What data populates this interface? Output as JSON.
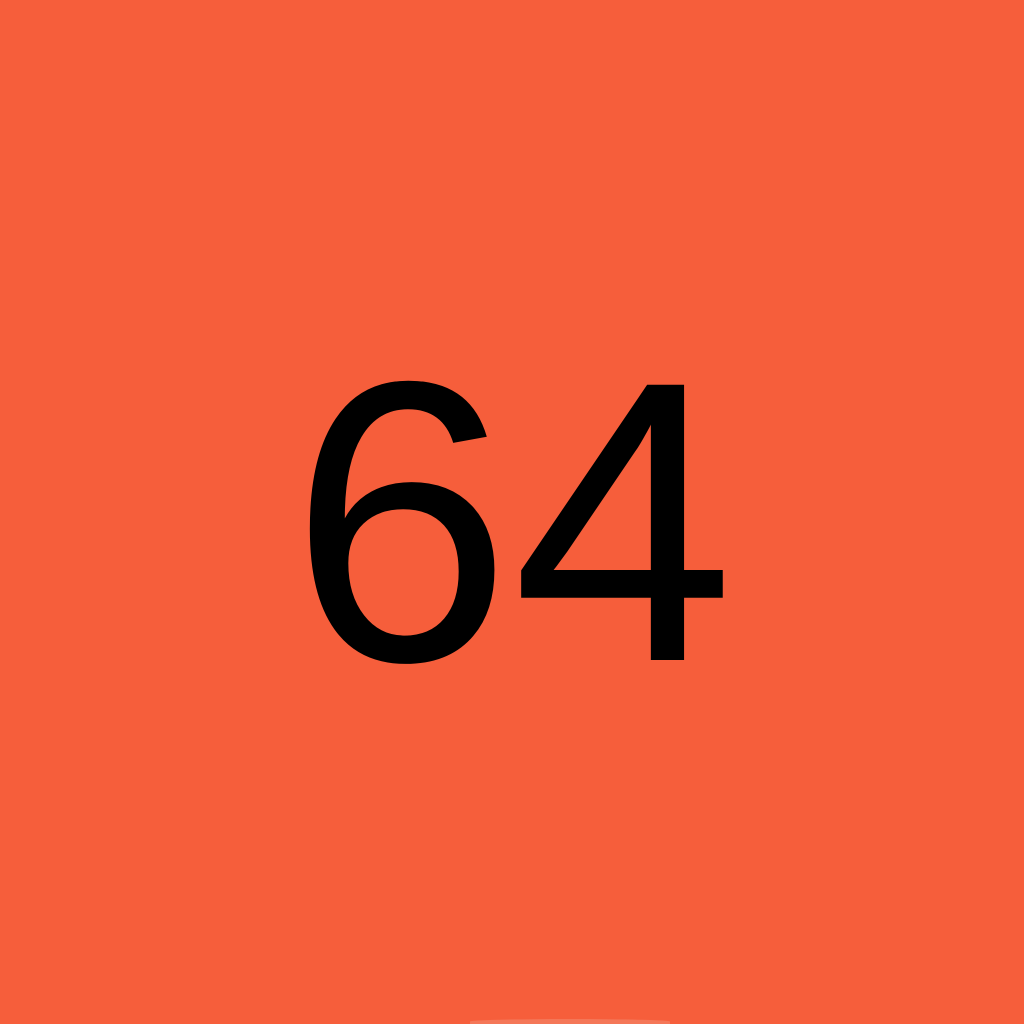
{
  "tile": {
    "value": "64",
    "background_color": "#f65e3b",
    "text_color": "#000000"
  }
}
